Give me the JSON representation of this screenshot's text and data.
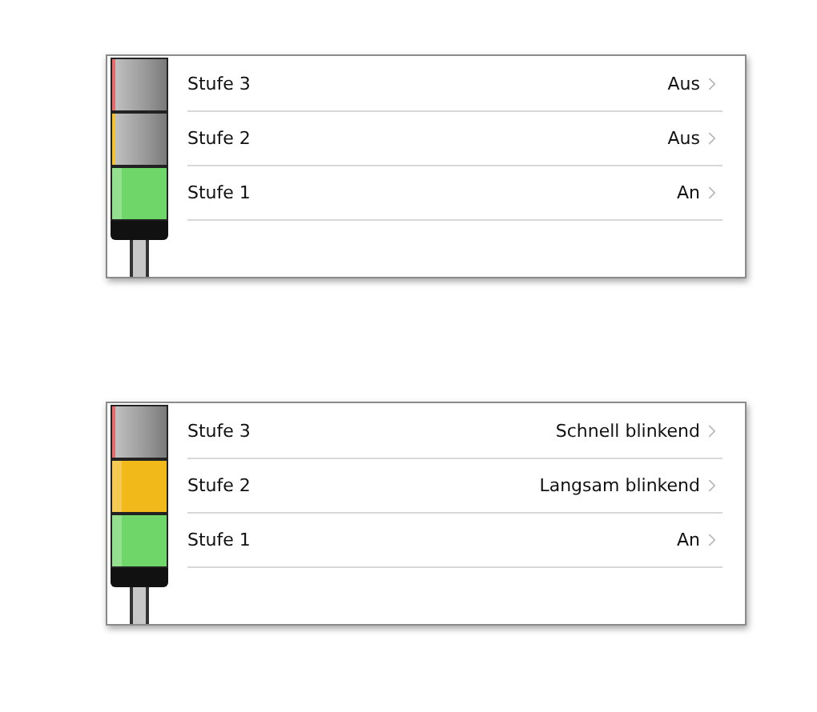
{
  "panels": [
    {
      "rows": [
        {
          "label": "Stufe 3",
          "value": "Aus",
          "lit": false,
          "color": "#e86a6a"
        },
        {
          "label": "Stufe 2",
          "value": "Aus",
          "lit": false,
          "color": "#f2c230"
        },
        {
          "label": "Stufe 1",
          "value": "An",
          "lit": true,
          "color": "#6fd66a"
        }
      ]
    },
    {
      "rows": [
        {
          "label": "Stufe 3",
          "value": "Schnell blinkend",
          "lit": false,
          "color": "#e86a6a"
        },
        {
          "label": "Stufe 2",
          "value": "Langsam blinkend",
          "lit": true,
          "color": "#f2b91a"
        },
        {
          "label": "Stufe 1",
          "value": "An",
          "lit": true,
          "color": "#6fd66a"
        }
      ]
    }
  ]
}
